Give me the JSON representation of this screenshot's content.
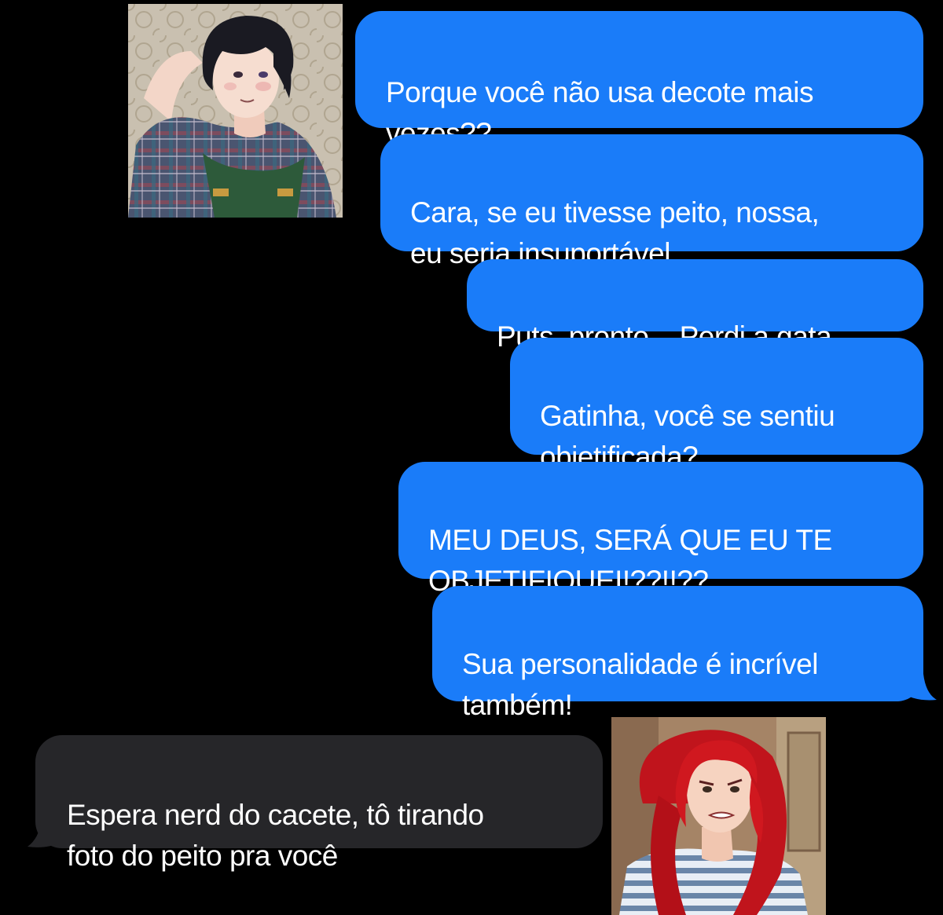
{
  "conversation": {
    "messages": [
      {
        "from": "me",
        "text": "Porque você não usa decote mais\nvezes??"
      },
      {
        "from": "me",
        "text": "Cara, se eu tivesse peito, nossa,\neu seria insuportável"
      },
      {
        "from": "me",
        "text": "Puts, pronto... Perdi a gata"
      },
      {
        "from": "me",
        "text": "Gatinha, você se sentiu\nobjetificada?"
      },
      {
        "from": "me",
        "text": "MEU DEUS, SERÁ QUE EU TE\nOBJETIFIQUEI!??!!??"
      },
      {
        "from": "me",
        "text": "Sua personalidade é incrível\ntambém!"
      },
      {
        "from": "them",
        "text": "Espera nerd do cacete, tô tirando\nfoto do peito pra você"
      }
    ]
  },
  "avatars": {
    "sender": {
      "icon": "boy-plaid-shirt-avatar"
    },
    "receiver": {
      "icon": "red-haired-girl-avatar"
    }
  },
  "colors": {
    "sent_bubble": "#1a7cf9",
    "received_bubble": "#262629",
    "background": "#000000",
    "text": "#ffffff"
  }
}
